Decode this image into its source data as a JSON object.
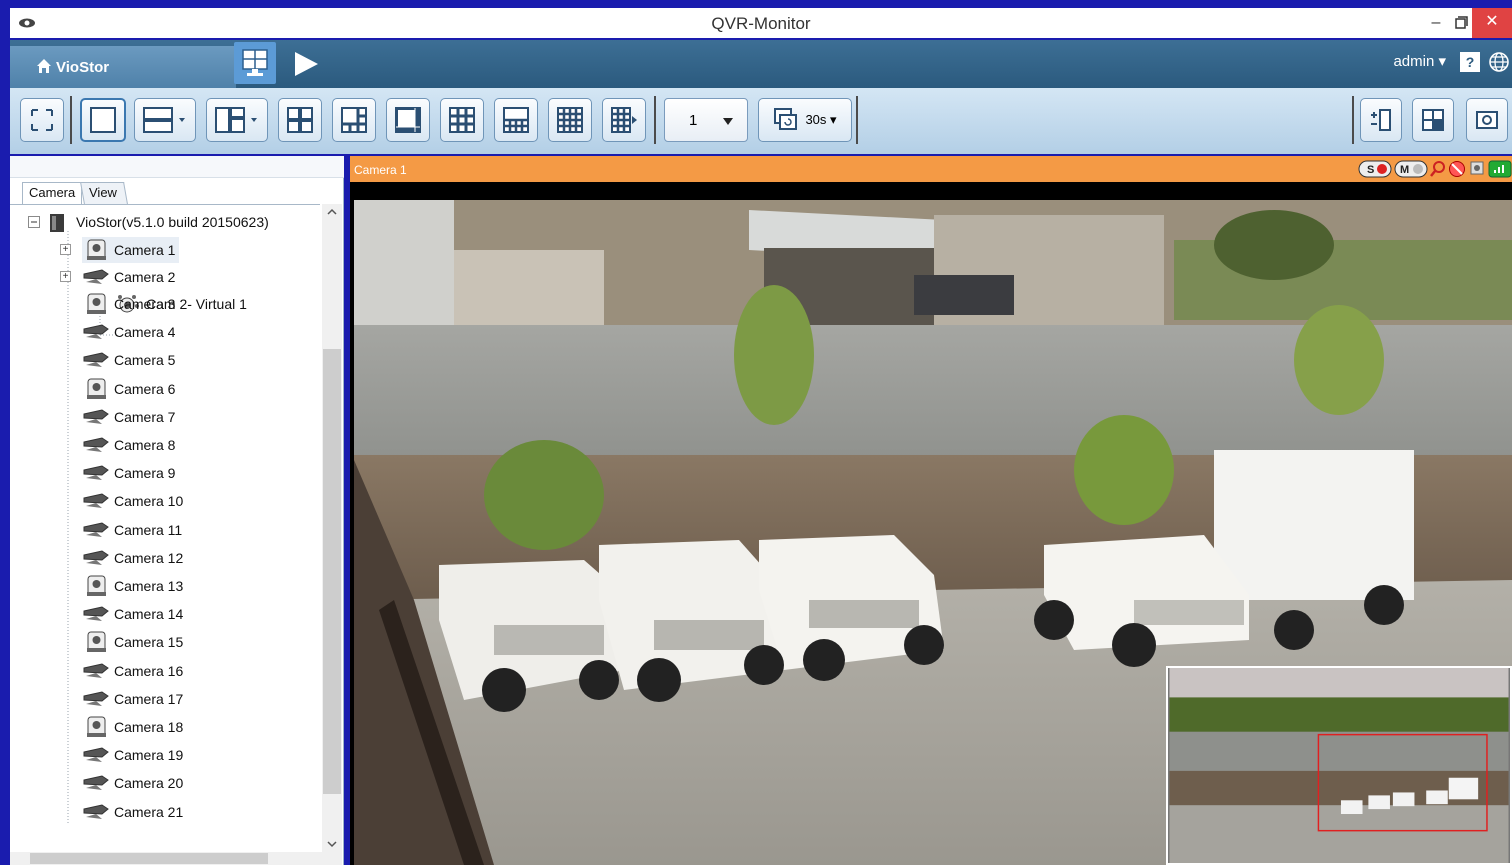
{
  "window": {
    "title": "QVR-Monitor",
    "minimize": "–",
    "close": "✕"
  },
  "navbar": {
    "home_label": "VioStor",
    "user": "admin ▾",
    "help": "?"
  },
  "toolbar": {
    "page_value": "1",
    "sequence_interval": "30s ▾"
  },
  "sidebar": {
    "tabs": [
      "Camera",
      "View"
    ],
    "root": "VioStor(v5.1.0 build 20150623)",
    "items": [
      {
        "label": "Camera 1",
        "icon": "ptz-camera-icon"
      },
      {
        "label": "Camera 2",
        "icon": "bullet-camera-icon"
      },
      {
        "label": "Cam 2- Virtual 1",
        "icon": "virtual-camera-icon"
      },
      {
        "label": "Camera 3",
        "icon": "ptz-camera-icon"
      },
      {
        "label": "Camera 4",
        "icon": "bullet-camera-icon"
      },
      {
        "label": "Camera 5",
        "icon": "bullet-camera-icon"
      },
      {
        "label": "Camera 6",
        "icon": "ptz-camera-icon"
      },
      {
        "label": "Camera 7",
        "icon": "bullet-camera-icon"
      },
      {
        "label": "Camera 8",
        "icon": "bullet-camera-icon"
      },
      {
        "label": "Camera 9",
        "icon": "bullet-camera-icon"
      },
      {
        "label": "Camera 10",
        "icon": "bullet-camera-icon"
      },
      {
        "label": "Camera 11",
        "icon": "bullet-camera-icon"
      },
      {
        "label": "Camera 12",
        "icon": "bullet-camera-icon"
      },
      {
        "label": "Camera 13",
        "icon": "ptz-camera-icon"
      },
      {
        "label": "Camera 14",
        "icon": "bullet-camera-icon"
      },
      {
        "label": "Camera 15",
        "icon": "ptz-camera-icon"
      },
      {
        "label": "Camera 16",
        "icon": "bullet-camera-icon"
      },
      {
        "label": "Camera 17",
        "icon": "bullet-camera-icon"
      },
      {
        "label": "Camera 18",
        "icon": "ptz-camera-icon"
      },
      {
        "label": "Camera 19",
        "icon": "bullet-camera-icon"
      },
      {
        "label": "Camera 20",
        "icon": "bullet-camera-icon"
      },
      {
        "label": "Camera 21",
        "icon": "bullet-camera-icon"
      }
    ]
  },
  "video": {
    "camera_title": "Camera 1",
    "status_badges": [
      "S",
      "M"
    ]
  },
  "colors": {
    "background": "#1a1cae",
    "camera_header": "#f49a45",
    "nav": "#2b5a7e",
    "toolbar": "#c4dcef",
    "close": "#e04343"
  }
}
